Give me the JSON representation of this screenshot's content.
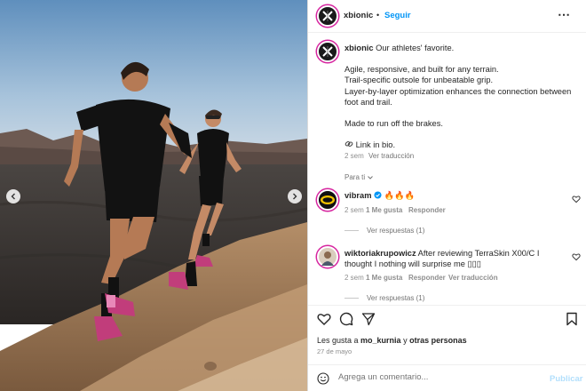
{
  "post": {
    "username": "xbionic",
    "follow_label": "Seguir",
    "separator": "•",
    "more": "⋯"
  },
  "caption": {
    "username": "xbionic",
    "title": " Our athletes' favorite.",
    "lines": [
      "Agile, responsive, and built for any terrain.",
      "Trail-specific outsole for unbeatable grip.",
      "Layer-by-layer optimization enhances the connection between foot and trail.",
      "Made to run off the brakes.",
      "Link in bio."
    ],
    "time": "2 sem",
    "see_translation": "Ver traducción",
    "para_ti": "Para ti"
  },
  "comments": [
    {
      "username": "vibram",
      "text": "🔥🔥🔥",
      "time": "2 sem",
      "likes": "1 Me gusta",
      "reply": "Responder",
      "view_replies": "Ver respuestas (1)",
      "verified": true
    },
    {
      "username": "wiktoriakrupowicz",
      "text": " After reviewing TerraSkin X00/C I thought I nothing will surprise me ▯▯▯",
      "time": "2 sem",
      "likes": "1 Me gusta",
      "reply": "Responder",
      "see_translation": "Ver traducción",
      "view_replies": "Ver respuestas (1)"
    }
  ],
  "footer": {
    "likes_prefix": "Les gusta a ",
    "likes_user": "mo_kurnia",
    "likes_mid": " y ",
    "likes_others": "otras personas",
    "date": "27 de mayo",
    "comment_placeholder": "Agrega un comentario...",
    "publish": "Publicar"
  },
  "colors": {
    "accent": "#0095f6",
    "verified": "#0095f6",
    "publish_disabled": "#b2dffc"
  },
  "icons": [
    "chevron-left-icon",
    "chevron-right-icon",
    "heart-icon",
    "comment-icon",
    "share-icon",
    "bookmark-icon",
    "emoji-icon",
    "link-icon",
    "verified-icon",
    "more-icon"
  ]
}
